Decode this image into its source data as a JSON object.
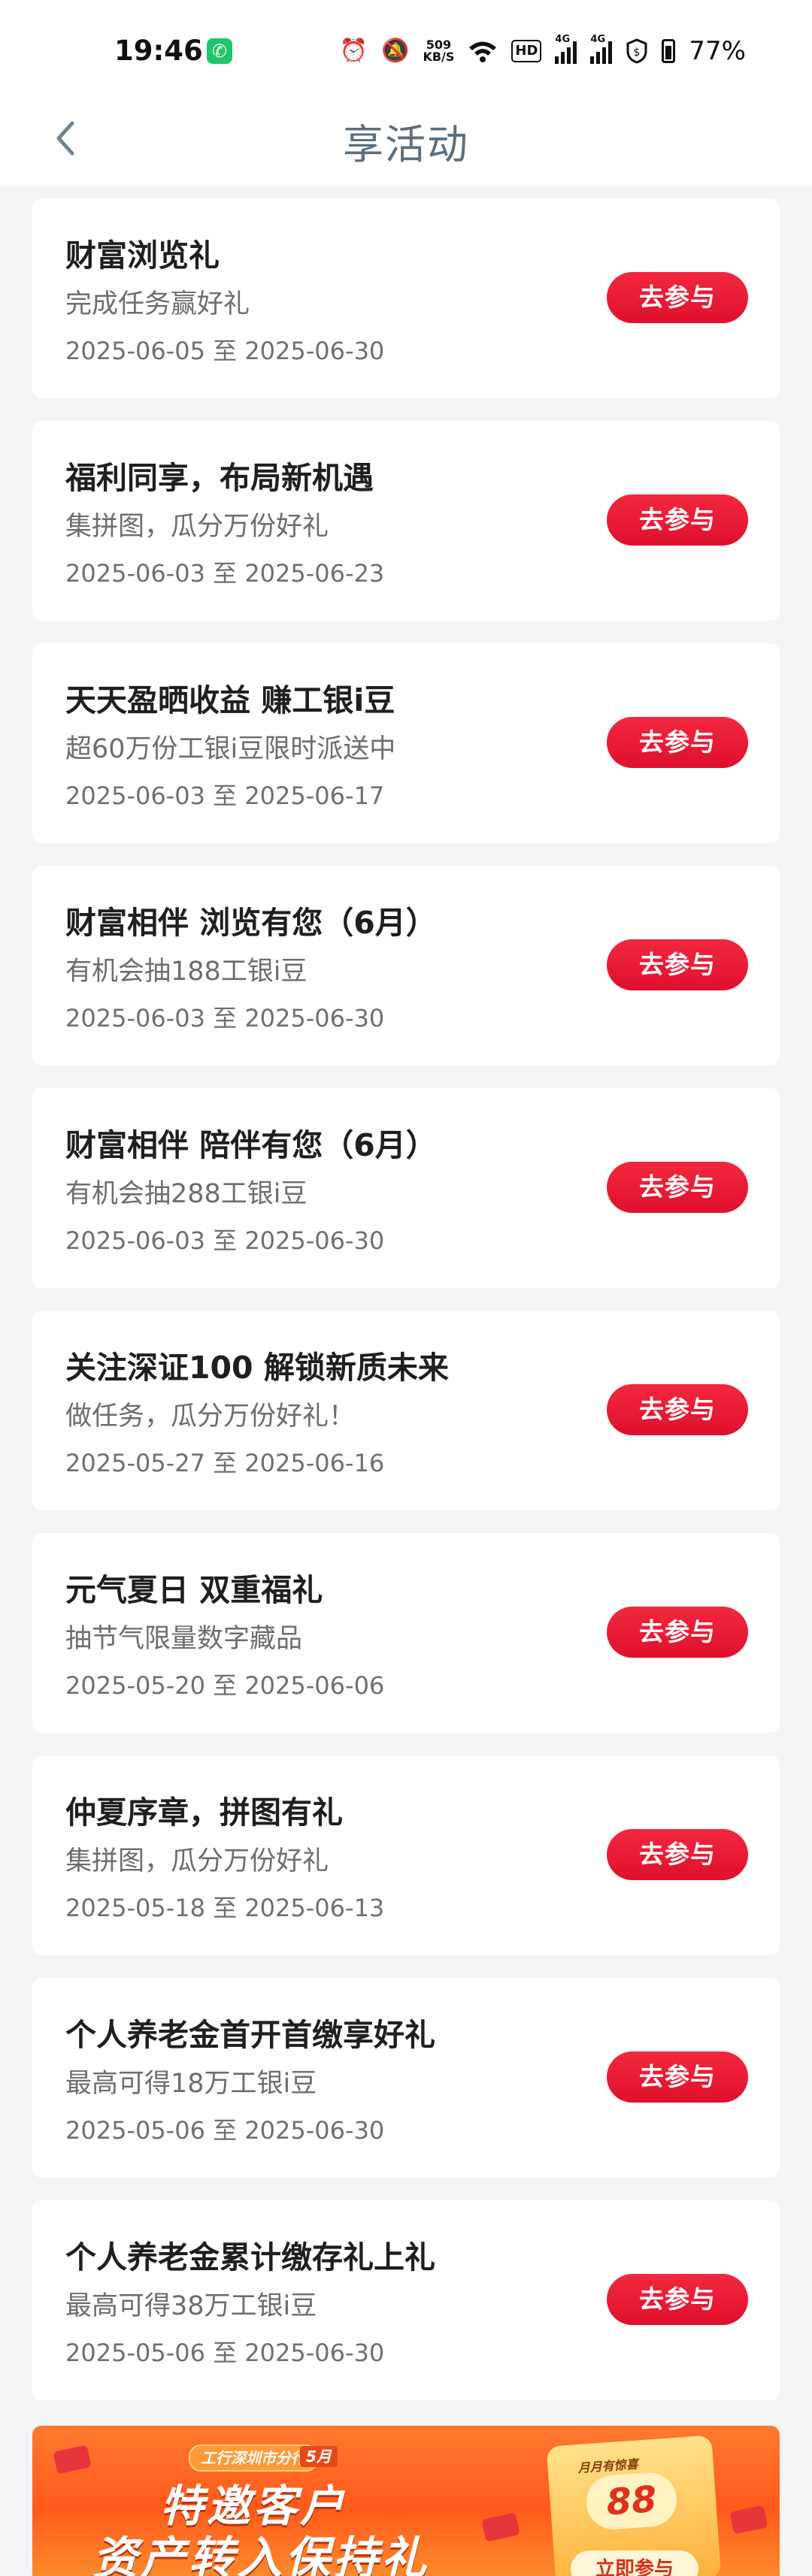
{
  "status_bar": {
    "time": "19:46",
    "net_speed_value": "509",
    "net_speed_unit": "KB/S",
    "hd_label": "HD",
    "signal_label": "4G",
    "battery": "77%",
    "icons": [
      "phone-call-icon",
      "alarm-icon",
      "mute-icon",
      "wifi-icon",
      "hd-icon",
      "signal-4g-icon",
      "signal-4g-icon",
      "shield-icon",
      "battery-icon"
    ]
  },
  "header": {
    "title": "享活动",
    "back_icon": "chevron-left-icon"
  },
  "activities": [
    {
      "title": "财富浏览礼",
      "subtitle": "完成任务赢好礼",
      "date": "2025-06-05 至 2025-06-30",
      "button": "去参与"
    },
    {
      "title": "福利同享，布局新机遇",
      "subtitle": "集拼图，瓜分万份好礼",
      "date": "2025-06-03 至 2025-06-23",
      "button": "去参与"
    },
    {
      "title": "天天盈晒收益 赚工银i豆",
      "subtitle": "超60万份工银i豆限时派送中",
      "date": "2025-06-03 至 2025-06-17",
      "button": "去参与"
    },
    {
      "title": "财富相伴 浏览有您（6月）",
      "subtitle": "有机会抽188工银i豆",
      "date": "2025-06-03 至 2025-06-30",
      "button": "去参与"
    },
    {
      "title": "财富相伴 陪伴有您（6月）",
      "subtitle": "有机会抽288工银i豆",
      "date": "2025-06-03 至 2025-06-30",
      "button": "去参与"
    },
    {
      "title": "关注深证100 解锁新质未来",
      "subtitle": "做任务，瓜分万份好礼！",
      "date": "2025-05-27 至 2025-06-16",
      "button": "去参与"
    },
    {
      "title": "元气夏日 双重福礼",
      "subtitle": "抽节气限量数字藏品",
      "date": "2025-05-20 至 2025-06-06",
      "button": "去参与"
    },
    {
      "title": "仲夏序章，拼图有礼",
      "subtitle": "集拼图，瓜分万份好礼",
      "date": "2025-05-18 至 2025-06-13",
      "button": "去参与"
    },
    {
      "title": "个人养老金首开首缴享好礼",
      "subtitle": "最高可得18万工银i豆",
      "date": "2025-05-06 至 2025-06-30",
      "button": "去参与"
    },
    {
      "title": "个人养老金累计缴存礼上礼",
      "subtitle": "最高可得38万工银i豆",
      "date": "2025-05-06 至 2025-06-30",
      "button": "去参与"
    }
  ],
  "banner": {
    "branch": "工行深圳市分行",
    "month": "5月",
    "title": "特邀客户",
    "subtitle": "资产转入保持礼",
    "gift_label": "月月有惊喜",
    "gift_amount": "88",
    "gift_caption": "",
    "cta": "立即参与"
  },
  "colors": {
    "accent_red": "#e8142f",
    "page_bg": "#f5f5f7",
    "title_gray": "#5b6f80"
  }
}
